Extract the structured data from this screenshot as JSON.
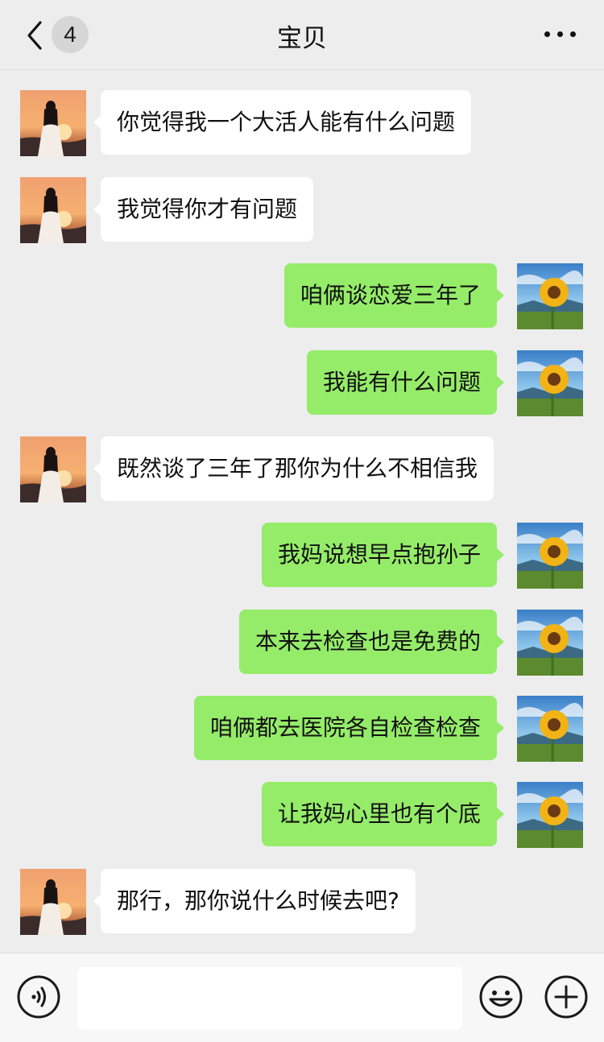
{
  "header": {
    "unread_count": "4",
    "title": "宝贝",
    "back_icon": "chevron-left-icon",
    "more_icon": "more-horizontal-icon"
  },
  "messages": [
    {
      "side": "left",
      "text": "你觉得我一个大活人能有什么问题"
    },
    {
      "side": "left",
      "text": "我觉得你才有问题"
    },
    {
      "side": "right",
      "text": "咱俩谈恋爱三年了"
    },
    {
      "side": "right",
      "text": "我能有什么问题"
    },
    {
      "side": "left",
      "text": "既然谈了三年了那你为什么不相信我"
    },
    {
      "side": "right",
      "text": "我妈说想早点抱孙子"
    },
    {
      "side": "right",
      "text": "本来去检查也是免费的"
    },
    {
      "side": "right",
      "text": "咱俩都去医院各自检查检查"
    },
    {
      "side": "right",
      "text": "让我妈心里也有个底"
    },
    {
      "side": "left",
      "text": "那行，那你说什么时候去吧?"
    }
  ],
  "input_bar": {
    "voice_icon": "voice-icon",
    "input_value": "",
    "emoji_icon": "emoji-icon",
    "plus_icon": "plus-circle-icon"
  },
  "colors": {
    "background": "#ededed",
    "sent_bubble": "#95ec69",
    "received_bubble": "#ffffff"
  }
}
